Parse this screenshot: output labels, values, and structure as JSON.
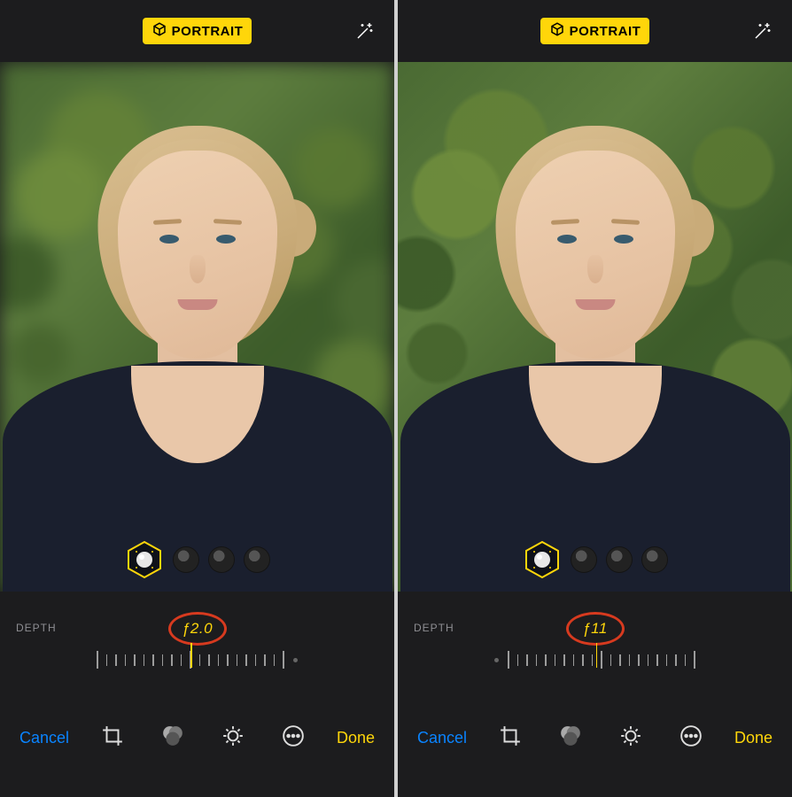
{
  "left": {
    "badge": "PORTRAIT",
    "depth_label": "DEPTH",
    "f_value": "ƒ2.0",
    "cancel": "Cancel",
    "done": "Done"
  },
  "right": {
    "badge": "PORTRAIT",
    "depth_label": "DEPTH",
    "f_value": "ƒ11",
    "cancel": "Cancel",
    "done": "Done"
  },
  "colors": {
    "accent_yellow": "#ffd60a",
    "ios_blue": "#0a84ff",
    "annotation_red": "#d73a1f"
  }
}
